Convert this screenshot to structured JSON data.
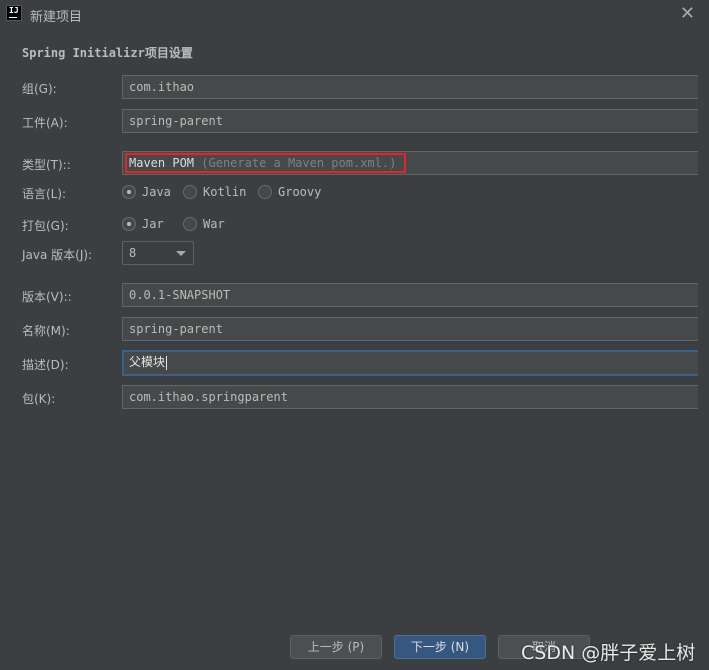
{
  "window": {
    "title": "新建项目",
    "app_icon_text": "IJ"
  },
  "section": {
    "title": "Spring Initializr项目设置"
  },
  "fields": {
    "group": {
      "label": "组(G):",
      "value": "com.ithao"
    },
    "artifact": {
      "label": "工件(A):",
      "value": "spring-parent"
    },
    "type": {
      "label": "类型(T)::",
      "value": "Maven POM",
      "hint": "(Generate a Maven pom.xml.)"
    },
    "language": {
      "label": "语言(L):",
      "options": [
        "Java",
        "Kotlin",
        "Groovy"
      ],
      "selected": "Java"
    },
    "packaging": {
      "label": "打包(G):",
      "options": [
        "Jar",
        "War"
      ],
      "selected": "Jar"
    },
    "java_version": {
      "label": "Java 版本(J):",
      "value": "8"
    },
    "version": {
      "label": "版本(V)::",
      "value": "0.0.1-SNAPSHOT"
    },
    "name": {
      "label": "名称(M):",
      "value": "spring-parent"
    },
    "description": {
      "label": "描述(D):",
      "value": "父模块"
    },
    "package": {
      "label": "包(K):",
      "value": "com.ithao.springparent"
    }
  },
  "buttons": {
    "previous": "上一步 (P)",
    "next": "下一步 (N)",
    "cancel": "取消"
  },
  "watermark": "CSDN @胖子爱上树",
  "colors": {
    "background": "#3c3f41",
    "field_bg": "#45494a",
    "primary_button": "#365880",
    "highlight_border": "#e0262b",
    "focus_border": "#3d6185"
  }
}
